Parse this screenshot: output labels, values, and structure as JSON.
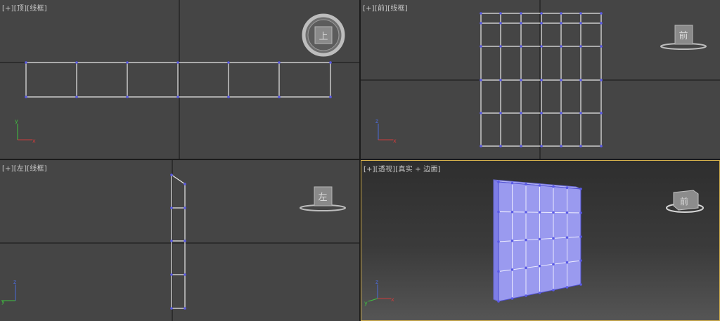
{
  "viewports": {
    "top": {
      "label_plus": "[+]",
      "label_view": "[顶]",
      "label_mode": "[线框]",
      "cube_face": "上"
    },
    "front": {
      "label_plus": "[+]",
      "label_view": "[前]",
      "label_mode": "[线框]",
      "cube_face": "前"
    },
    "left": {
      "label_plus": "[+]",
      "label_view": "[左]",
      "label_mode": "[线框]",
      "cube_face": "左"
    },
    "perspective": {
      "label_plus": "[+]",
      "label_view": "[透视]",
      "label_mode": "[真实 + 边面]",
      "cube_face": "前"
    }
  },
  "axes": {
    "x": "x",
    "y": "y",
    "z": "z"
  },
  "colors": {
    "viewport_bg": "#454545",
    "wire": "#e8e8e8",
    "vertex": "#5a5ae6",
    "mesh_fill": "#9a9aef",
    "active_border": "#d4b04c",
    "axis_x": "#d03a3a",
    "axis_y": "#3ec33e",
    "axis_z": "#4c6bd8"
  }
}
